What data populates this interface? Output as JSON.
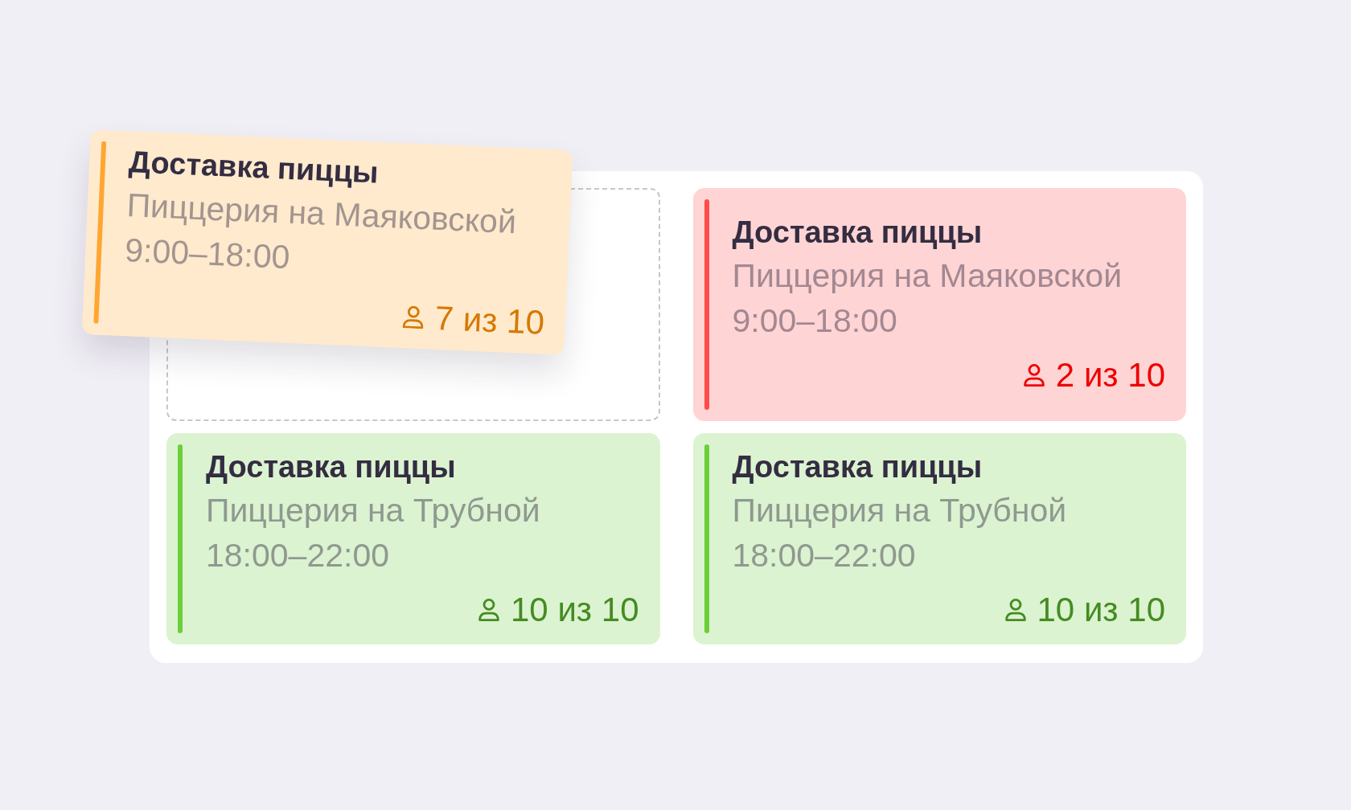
{
  "board": {
    "slots": [
      {
        "kind": "drop_target"
      },
      {
        "kind": "card",
        "title": "Доставка пиццы",
        "place": "Пиццерия на Маяковской",
        "hours": "9:00–18:00",
        "staffed": "2 из 10",
        "color": "#ff4b4b"
      },
      {
        "kind": "card",
        "title": "Доставка пиццы",
        "place": "Пиццерия на Трубной",
        "hours": "18:00–22:00",
        "staffed": "10 из 10",
        "color": "#6bcf3a"
      },
      {
        "kind": "card",
        "title": "Доставка пиццы",
        "place": "Пиццерия на Трубной",
        "hours": "18:00–22:00",
        "staffed": "10 из 10",
        "color": "#6bcf3a"
      }
    ]
  },
  "dragged_card": {
    "title": "Доставка пиццы",
    "place": "Пиццерия на Маяковской",
    "hours": "9:00–18:00",
    "staffed": "7 из 10",
    "color": "#ffa632"
  }
}
